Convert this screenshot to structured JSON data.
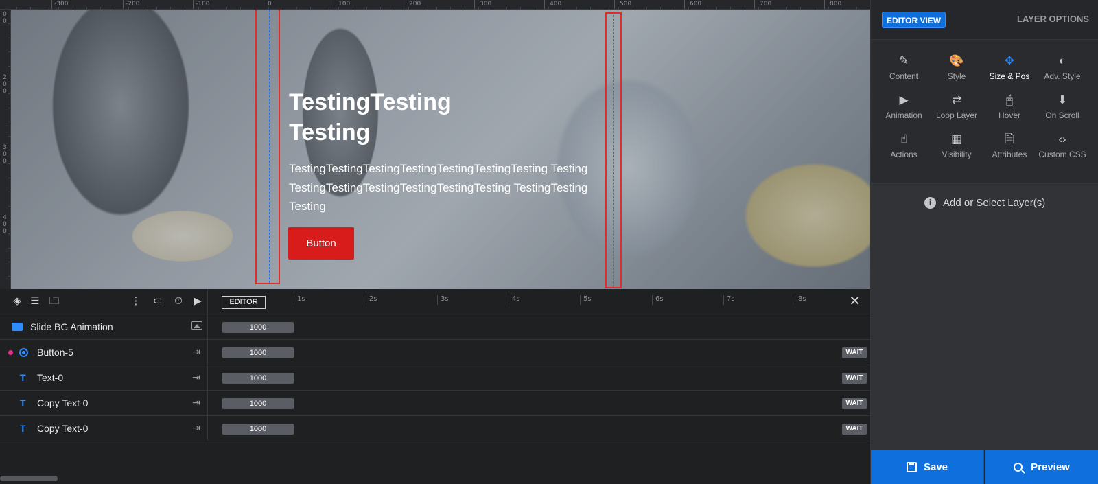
{
  "ruler": {
    "top_labels": [
      "-300",
      "-200",
      "-100",
      "0",
      "100",
      "200",
      "300",
      "400",
      "500",
      "600",
      "700",
      "800"
    ],
    "left_labels": [
      "0\n0",
      "2\n0\n0",
      "3\n0\n0",
      "4\n0\n0"
    ]
  },
  "canvas": {
    "title": "TestingTesting Testing",
    "body": "TestingTestingTestingTestingTestingTestingTesting TestingTestingTestingTestingTestingTestingTesting TestingTestingTesting",
    "button_label": "Button"
  },
  "timeline": {
    "editor_label": "EDITOR",
    "seconds": [
      "1s",
      "2s",
      "3s",
      "4s",
      "5s",
      "6s",
      "7s",
      "8s"
    ],
    "layers": [
      {
        "name": "Slide BG Animation",
        "duration": "1000",
        "wait": ""
      },
      {
        "name": "Button-5",
        "duration": "1000",
        "wait": "WAIT"
      },
      {
        "name": "Text-0",
        "duration": "1000",
        "wait": "WAIT"
      },
      {
        "name": "Copy Text-0",
        "duration": "1000",
        "wait": "WAIT"
      },
      {
        "name": "Copy Text-0",
        "duration": "1000",
        "wait": "WAIT"
      }
    ],
    "text_icon": "T",
    "close_glyph": "✕"
  },
  "panel": {
    "editor_view": "EDITOR VIEW",
    "layer_options": "LAYER OPTIONS",
    "tools": [
      {
        "label": "Content",
        "icon": "✎"
      },
      {
        "label": "Style",
        "icon": "🎨"
      },
      {
        "label": "Size & Pos",
        "icon": "✥"
      },
      {
        "label": "Adv. Style",
        "icon": "◐"
      },
      {
        "label": "Animation",
        "icon": "▶"
      },
      {
        "label": "Loop Layer",
        "icon": "⇄"
      },
      {
        "label": "Hover",
        "icon": "🖱"
      },
      {
        "label": "On Scroll",
        "icon": "⬇"
      },
      {
        "label": "Actions",
        "icon": "☝"
      },
      {
        "label": "Visibility",
        "icon": "▦"
      },
      {
        "label": "Attributes",
        "icon": "🗎"
      },
      {
        "label": "Custom CSS",
        "icon": "‹›"
      }
    ],
    "active_tool": "Size & Pos",
    "info_text": "Add or Select Layer(s)",
    "info_glyph": "i",
    "save_label": "Save",
    "preview_label": "Preview"
  },
  "colors": {
    "accent": "#0f6fdc",
    "cta_red": "#d81c1c",
    "guide_red": "#e62a2a",
    "layer_blue": "#2f8cff",
    "marker_pink": "#e8318a"
  }
}
